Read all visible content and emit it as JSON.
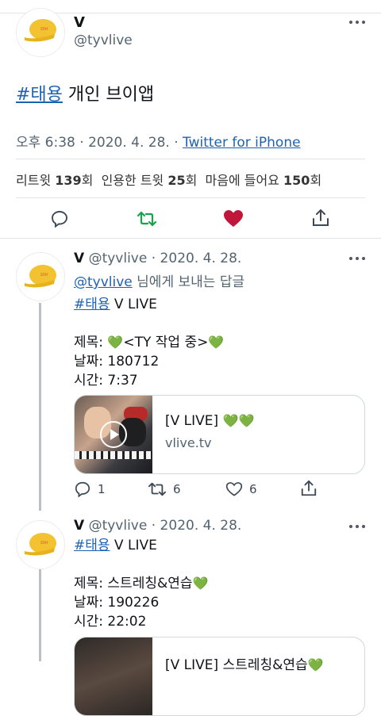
{
  "colors": {
    "link": "#1d62b4",
    "retweet": "#17a34a",
    "like": "#c0163a",
    "muted": "#536471"
  },
  "main_tweet": {
    "name": "V",
    "handle": "@tyvlive",
    "hashtag": "#태용",
    "text": "개인 브이앱",
    "time": "오후 6:38 · 2020. 4. 28. · ",
    "source": "Twitter for iPhone",
    "stats": {
      "retweets_label": "리트윗",
      "retweets_count": "139",
      "retweets_unit": "회",
      "quotes_label": "인용한 트윗",
      "quotes_count": "25",
      "quotes_unit": "회",
      "likes_label": "마음에 들어요",
      "likes_count": "150",
      "likes_unit": "회"
    },
    "icons": [
      "reply-icon",
      "retweet-icon",
      "heart-icon",
      "share-icon"
    ]
  },
  "reply1": {
    "name": "V",
    "handle": "@tyvlive",
    "date": "· 2020. 4. 28.",
    "reply_to_handle": "@tyvlive",
    "reply_to_text": " 님에게 보내는 답글",
    "hashtag": "#태용",
    "hashtag_rest": " V LIVE",
    "line_title_prefix": "제목: ",
    "line_title_text": "<TY 작업 중>",
    "line_date": "날짜: 180712",
    "line_time": "시간: 7:37",
    "card_title": "[V LIVE] ",
    "card_domain": "vlive.tv",
    "reply_count": "1",
    "retweet_count": "6",
    "like_count": "6"
  },
  "reply2": {
    "name": "V",
    "handle": "@tyvlive",
    "date": "· 2020. 4. 28.",
    "hashtag": "#태용",
    "hashtag_rest": " V LIVE",
    "line_title_prefix": "제목: ",
    "line_title_text": "스트레칭&연습",
    "line_date": "날짜: 190226",
    "line_time": "시간: 22:02",
    "card_title_partial": "[V LIVE] 스트레칭&연습"
  }
}
